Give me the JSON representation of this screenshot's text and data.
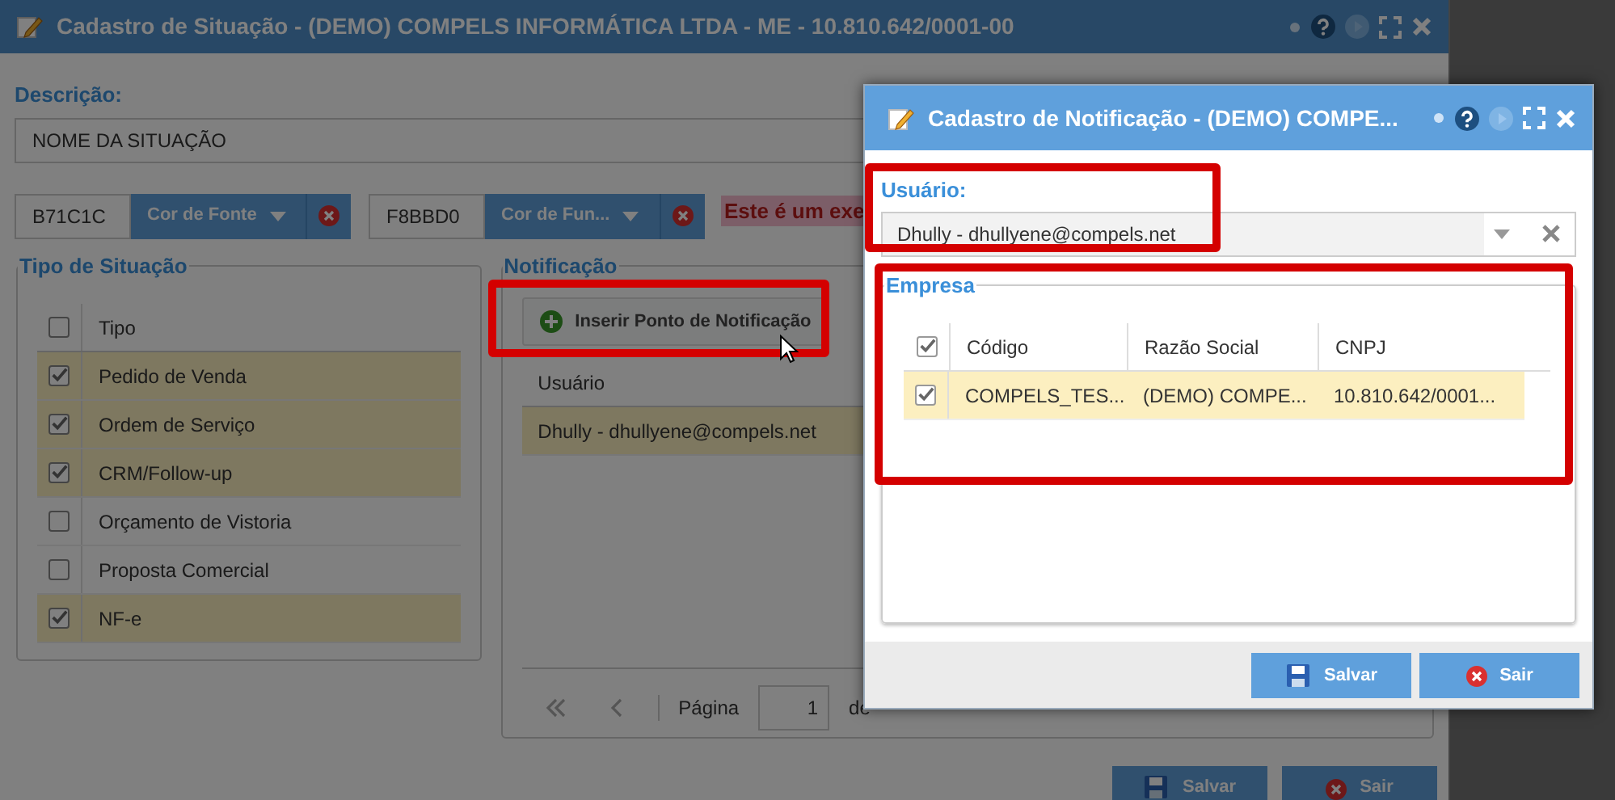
{
  "main_window": {
    "title": "Cadastro de Situação - (DEMO) COMPELS INFORMÁTICA LTDA - ME - 10.810.642/0001-00",
    "description_label": "Descrição:",
    "description_value": "NOME DA SITUAÇÃO",
    "font_color": {
      "value": "B71C1C",
      "button": "Cor de Fonte"
    },
    "background_color": {
      "value": "F8BBD0",
      "button": "Cor de Fun..."
    },
    "preview_text": "Este é um exe",
    "situation_types": {
      "legend": "Tipo de Situação",
      "column": "Tipo",
      "all_checked": false,
      "rows": [
        {
          "label": "Pedido de Venda",
          "checked": true
        },
        {
          "label": "Ordem de Serviço",
          "checked": true
        },
        {
          "label": "CRM/Follow-up",
          "checked": true
        },
        {
          "label": "Orçamento de Vistoria",
          "checked": false
        },
        {
          "label": "Proposta Comercial",
          "checked": false
        },
        {
          "label": "NF-e",
          "checked": true
        }
      ]
    },
    "notification": {
      "legend": "Notificação",
      "insert_button": "Inserir Ponto de Notificação",
      "column": "Usuário",
      "rows": [
        {
          "user": "Dhully - dhullyene@compels.net"
        }
      ],
      "pager": {
        "page_label": "Página",
        "page": "1",
        "of_label": "de"
      }
    },
    "buttons": [
      "Salvar",
      "Sair"
    ]
  },
  "dialog": {
    "title": "Cadastro de Notificação - (DEMO) COMPE...",
    "user_label": "Usuário:",
    "user_value": "Dhully - dhullyene@compels.net",
    "company": {
      "legend": "Empresa",
      "all_checked": true,
      "columns": [
        "Código",
        "Razão Social",
        "CNPJ"
      ],
      "rows": [
        {
          "cells": [
            "COMPELS_TES...",
            "(DEMO) COMPE...",
            "10.810.642/0001..."
          ],
          "checked": true
        }
      ]
    },
    "buttons": [
      "Salvar",
      "Sair"
    ]
  }
}
